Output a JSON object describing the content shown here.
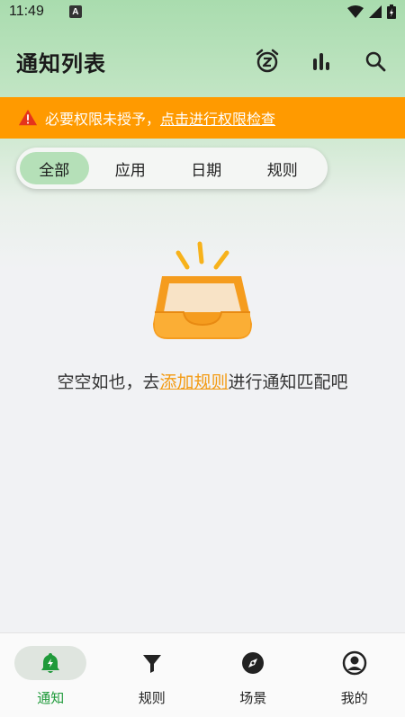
{
  "status_bar": {
    "time": "11:49",
    "notification_badge": "A",
    "icons": [
      "wifi-icon",
      "signal-icon",
      "battery-icon"
    ]
  },
  "app_bar": {
    "title": "通知列表",
    "actions": [
      "snooze-alarm-icon",
      "bar-chart-icon",
      "search-icon"
    ]
  },
  "warning": {
    "text": "必要权限未授予，",
    "link": "点击进行权限检查",
    "color": "#ff9a00"
  },
  "filter_tabs": [
    {
      "label": "全部",
      "active": true
    },
    {
      "label": "应用",
      "active": false
    },
    {
      "label": "日期",
      "active": false
    },
    {
      "label": "规则",
      "active": false
    }
  ],
  "empty_state": {
    "prefix": "空空如也，去",
    "link": "添加规则",
    "suffix": "进行通知匹配吧",
    "illustration": "empty-inbox-tray"
  },
  "bottom_nav": [
    {
      "label": "通知",
      "icon": "bell-icon",
      "active": true
    },
    {
      "label": "规则",
      "icon": "filter-icon",
      "active": false
    },
    {
      "label": "场景",
      "icon": "compass-icon",
      "active": false
    },
    {
      "label": "我的",
      "icon": "profile-icon",
      "active": false
    }
  ],
  "colors": {
    "accent_green": "#1f9a3a",
    "header_green": "#a9dcae",
    "warning_orange": "#ff9a00",
    "link_orange": "#f39b13"
  }
}
